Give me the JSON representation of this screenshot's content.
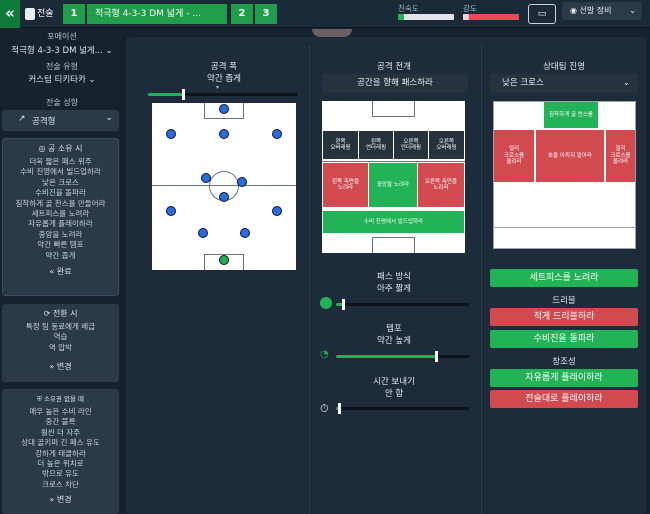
{
  "topbar": {
    "back_glyph": "«",
    "tactics_label": "전술",
    "slot1_num": "1",
    "slot1_name": "적극형 4-3-3 DM 넓게 - ...",
    "slot2_num": "2",
    "slot3_num": "3",
    "familiarity_label": "친숙도",
    "intensity_label": "강도",
    "sort_label": "선발 정비",
    "familiarity_level": 0.1,
    "intensity_level": 0.1
  },
  "sidebar": {
    "formation_label": "포메이션",
    "formation_value": "적극형 4-3-3 DM 넓게...",
    "style_label": "전술 유형",
    "style_value": "커스텀 티키타카",
    "mentality_label": "전술 성향",
    "mentality_value": "공격형",
    "in_possession": {
      "title": "공 소유 시",
      "items": [
        "더욱 짧은 패스 위주",
        "수비 진영에서 빌드업하라",
        "낮은 크로스",
        "수비진을 돌파라",
        "침착하게 골 찬스를 만들어라",
        "세트피스를 노려라",
        "자유롭게 플레이하라",
        "중앙을 노려라",
        "약간 빠른 템포",
        "약간 좁게"
      ],
      "button": "완료"
    },
    "transition": {
      "title": "전환 시",
      "items": [
        "특정 팀 동료에게 배급",
        "역습",
        "역 압박"
      ],
      "button": "변경"
    },
    "out_of_possession": {
      "title": "소유권 없을 때",
      "items": [
        "매우 높은 수비 라인",
        "중간 블록",
        "훨씬 더 자주",
        "상대 골키퍼 긴 패스 유도",
        "강하게 태클하라",
        "더 높은 위치로",
        "밖으로 유도",
        "크로스 차단"
      ],
      "button": "변경"
    }
  },
  "col1": {
    "title": "공격 폭",
    "value": "약간 좁게",
    "width_level": 0.23
  },
  "col2": {
    "title": "공격 전개",
    "dropdown": "공간을 향해 패스하라",
    "cells": {
      "left_overlap": "왼쪽\n오버래핑",
      "left_underlap": "왼쪽\n언더래핑",
      "right_underlap": "오른쪽\n언더래핑",
      "right_overlap": "오른쪽\n오버래핑",
      "left_half": "왼쪽 측면을\n노려라",
      "center_half": "중앙을 노려라",
      "right_half": "오른쪽 측면을\n노려라",
      "defense": "수비 진영에서 빌드업하라"
    },
    "pass_label": "패스 방식",
    "pass_value": "아주 짧게",
    "pass_level": 0.05,
    "tempo_label": "템포",
    "tempo_value": "약간 높게",
    "tempo_level": 0.75,
    "time_label": "시간 보내기",
    "time_value": "안 함",
    "time_level": 0.02
  },
  "col3": {
    "title": "상대팀 진영",
    "dropdown": "낮은 크로스",
    "cells": {
      "top": "침착하게 골 찬스를",
      "left": "얼리\n크로스를\n올려라",
      "center": "숏을 아끼지 말아라",
      "right": "얼리\n크로스를\n올려라"
    },
    "setpiece_button": "세트피스를 노려라",
    "dribble_label": "드리블",
    "dribble_btn1": "적게 드리블하라",
    "dribble_btn2": "수비진을 돌파라",
    "creative_label": "창조성",
    "creative_btn1": "자유롭게 플레이하라",
    "creative_btn2": "전술대로 플레이하라"
  },
  "colors": {
    "accent_green": "#22b356",
    "accent_red": "#d24a50",
    "dark_bg": "#16222e",
    "player_blue": "#2a6be0"
  }
}
